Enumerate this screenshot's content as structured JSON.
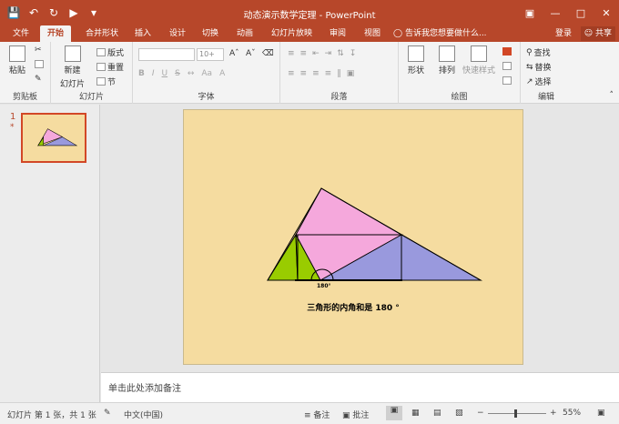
{
  "window": {
    "title": "动态演示数学定理 - PowerPoint"
  },
  "tabs": [
    {
      "label": "文件"
    },
    {
      "label": "开始"
    },
    {
      "label": "合并形状"
    },
    {
      "label": "插入"
    },
    {
      "label": "设计"
    },
    {
      "label": "切换"
    },
    {
      "label": "动画"
    },
    {
      "label": "幻灯片放映"
    },
    {
      "label": "审阅"
    },
    {
      "label": "视图"
    }
  ],
  "tell_me": "告诉我您想要做什么...",
  "account": {
    "login": "登录",
    "share": "共享"
  },
  "ribbon": {
    "clipboard": {
      "paste": "粘贴",
      "label": "剪贴板"
    },
    "slides": {
      "new_slide": "新建",
      "new_slide2": "幻灯片",
      "layout": "版式",
      "reset": "重置",
      "section": "节",
      "label": "幻灯片"
    },
    "font": {
      "size_value": "10+",
      "label": "字体"
    },
    "paragraph": {
      "label": "段落"
    },
    "drawing": {
      "shape": "形状",
      "arrange": "排列",
      "quick_styles": "快速样式",
      "label": "绘图"
    },
    "editing": {
      "find": "查找",
      "replace": "替换",
      "select": "选择",
      "label": "编辑"
    }
  },
  "thumbnail": {
    "number": "1",
    "marker": "*"
  },
  "slide": {
    "angle_label": "180°",
    "caption": "三角形的内角和是 180 °"
  },
  "notes": {
    "placeholder": "单击此处添加备注"
  },
  "statusbar": {
    "slide_info": "幻灯片 第 1 张，共 1 张",
    "language": "中文(中国)",
    "notes": "备注",
    "comments": "批注",
    "zoom": "55%"
  },
  "colors": {
    "accent": "#b7472a",
    "slide_bg": "#f5dca0",
    "pink": "#f5a8dc",
    "green": "#99cc00",
    "purple": "#9999dd"
  }
}
